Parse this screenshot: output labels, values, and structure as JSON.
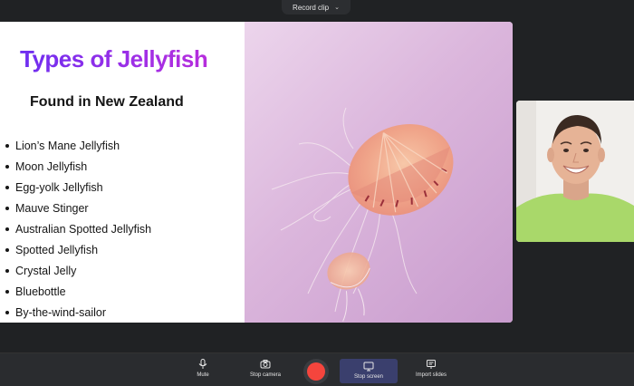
{
  "top_bar": {
    "label": "Record clip",
    "chevron_icon": "chevron-down-icon"
  },
  "slide": {
    "title": "Types of Jellyfish",
    "subtitle": "Found in New Zealand",
    "bullets": [
      "Lion’s Mane Jellyfish",
      "Moon Jellyfish",
      "Egg-yolk Jellyfish",
      "Mauve Stinger",
      "Australian Spotted Jellyfish",
      "Spotted Jellyfish",
      "Crystal Jelly",
      "Bluebottle",
      "By-the-wind-sailor"
    ],
    "image": "jellyfish-photo",
    "colors": {
      "title_start": "#6d2ef0",
      "title_end": "#c02dd8",
      "image_bg": "#dbb6dc"
    }
  },
  "camera": {
    "subject": "presenter-webcam"
  },
  "controls": {
    "mute": {
      "label": "Mute",
      "icon": "microphone-icon"
    },
    "stop_camera": {
      "label": "Stop camera",
      "icon": "camera-icon"
    },
    "record": {
      "icon": "record-icon",
      "color": "#f5453d"
    },
    "stop_screen": {
      "label": "Stop screen",
      "icon": "screen-icon"
    },
    "import_slides": {
      "label": "Import slides",
      "icon": "slides-icon"
    }
  }
}
